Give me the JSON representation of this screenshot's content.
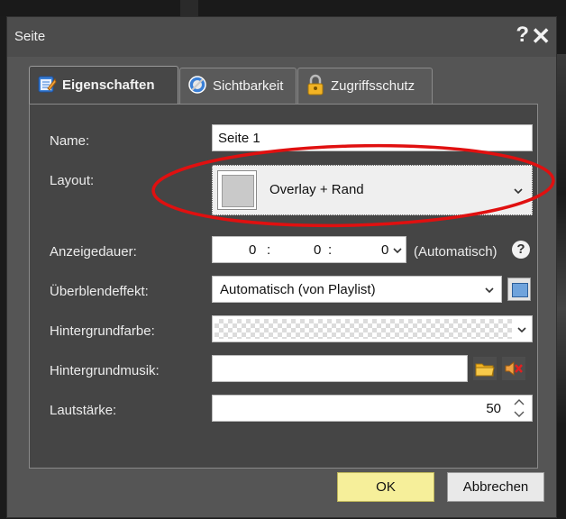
{
  "dialog": {
    "title": "Seite",
    "help_glyph": "?",
    "close_glyph": "✕"
  },
  "tabs": [
    {
      "label": "Eigenschaften",
      "icon": "notepad-pencil-icon",
      "active": true
    },
    {
      "label": "Sichtbarkeit",
      "icon": "eye-icon",
      "active": false
    },
    {
      "label": "Zugriffsschutz",
      "icon": "padlock-icon",
      "active": false
    }
  ],
  "form": {
    "name": {
      "label": "Name:",
      "value": "Seite 1"
    },
    "layout": {
      "label": "Layout:",
      "value": "Overlay + Rand"
    },
    "duration": {
      "label": "Anzeigedauer:",
      "h": "0",
      "m": "0",
      "s": "0",
      "sep1": ":",
      "sep2": ":",
      "auto_text": "(Automatisch)"
    },
    "transition": {
      "label": "Überblendeffekt:",
      "value": "Automatisch (von Playlist)"
    },
    "bgcolor": {
      "label": "Hintergrundfarbe:"
    },
    "bgmusic": {
      "label": "Hintergrundmusik:",
      "value": ""
    },
    "volume": {
      "label": "Lautstärke:",
      "value": "50"
    }
  },
  "buttons": {
    "ok": "OK",
    "cancel": "Abbrechen"
  },
  "colors": {
    "highlight_ellipse": "#e01010",
    "ok_button": "#f6ef9a",
    "dialog_bg": "#555555"
  }
}
